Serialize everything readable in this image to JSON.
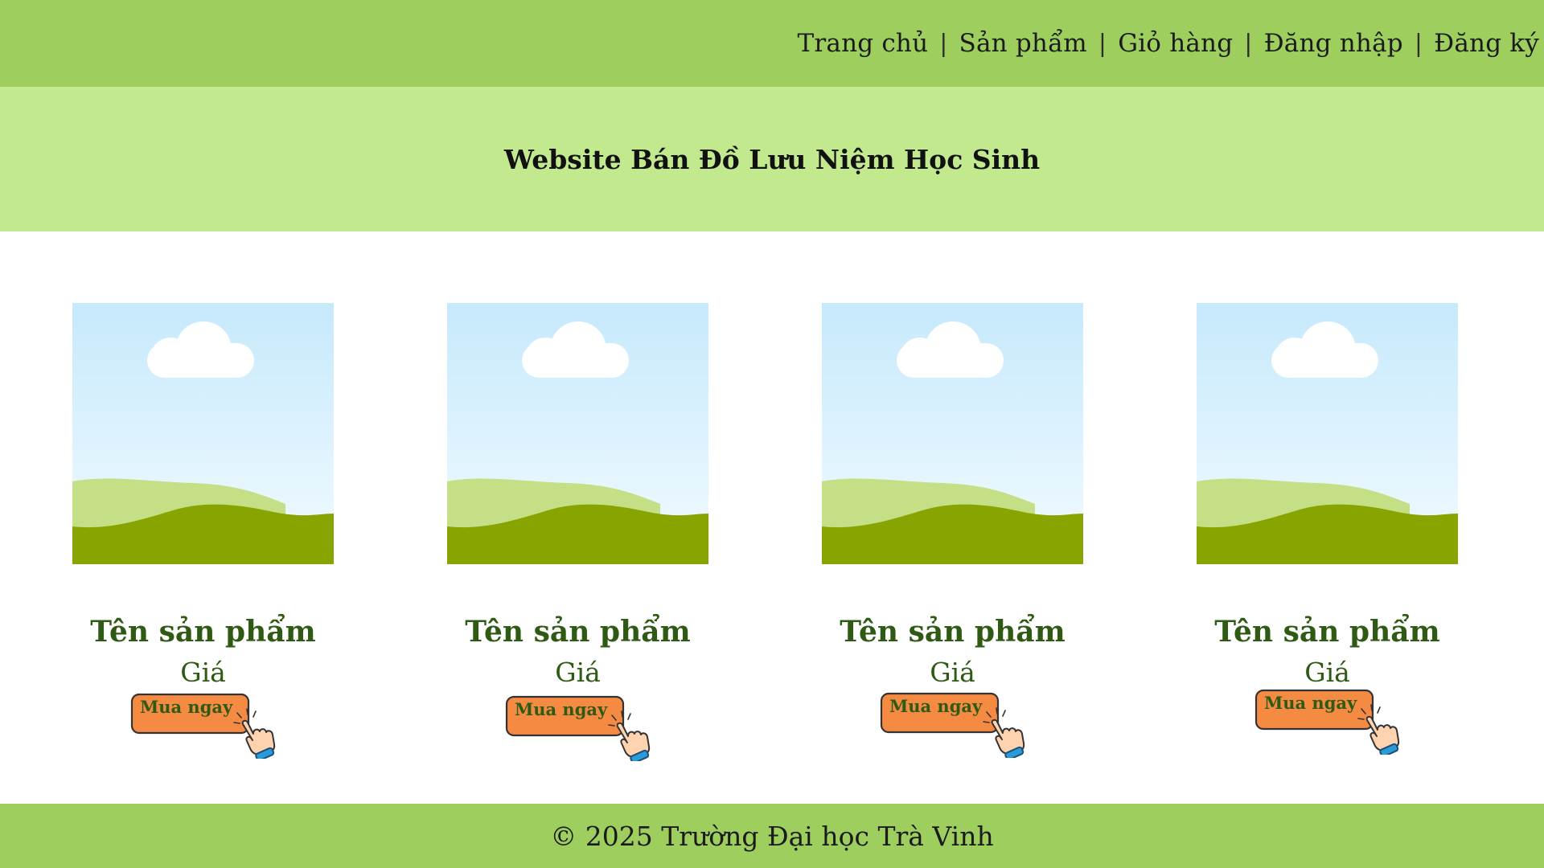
{
  "nav": {
    "items": [
      "Trang chủ",
      "Sản phẩm",
      "Giỏ hàng",
      "Đăng nhập",
      "Đăng ký"
    ],
    "separator": "|"
  },
  "banner": {
    "title": "Website Bán Đồ Lưu Niệm Học Sinh"
  },
  "products": [
    {
      "name": "Tên sản phẩm",
      "price": "Giá",
      "buy_label": "Mua ngay",
      "image_icon": "landscape-placeholder-icon"
    },
    {
      "name": "Tên sản phẩm",
      "price": "Giá",
      "buy_label": "Mua ngay",
      "image_icon": "landscape-placeholder-icon"
    },
    {
      "name": "Tên sản phẩm",
      "price": "Giá",
      "buy_label": "Mua ngay",
      "image_icon": "landscape-placeholder-icon"
    },
    {
      "name": "Tên sản phẩm",
      "price": "Giá",
      "buy_label": "Mua ngay",
      "image_icon": "landscape-placeholder-icon"
    }
  ],
  "footer": {
    "text": "© 2025 Trường Đại học Trà Vinh"
  },
  "colors": {
    "topbar": "#9ecf5e",
    "banner": "#c2e98e",
    "product_text": "#2f5a14",
    "buy_button": "#f58a42",
    "sky_top": "#c4e8fb",
    "grass_dark": "#88a400",
    "grass_light": "#c4df86"
  }
}
